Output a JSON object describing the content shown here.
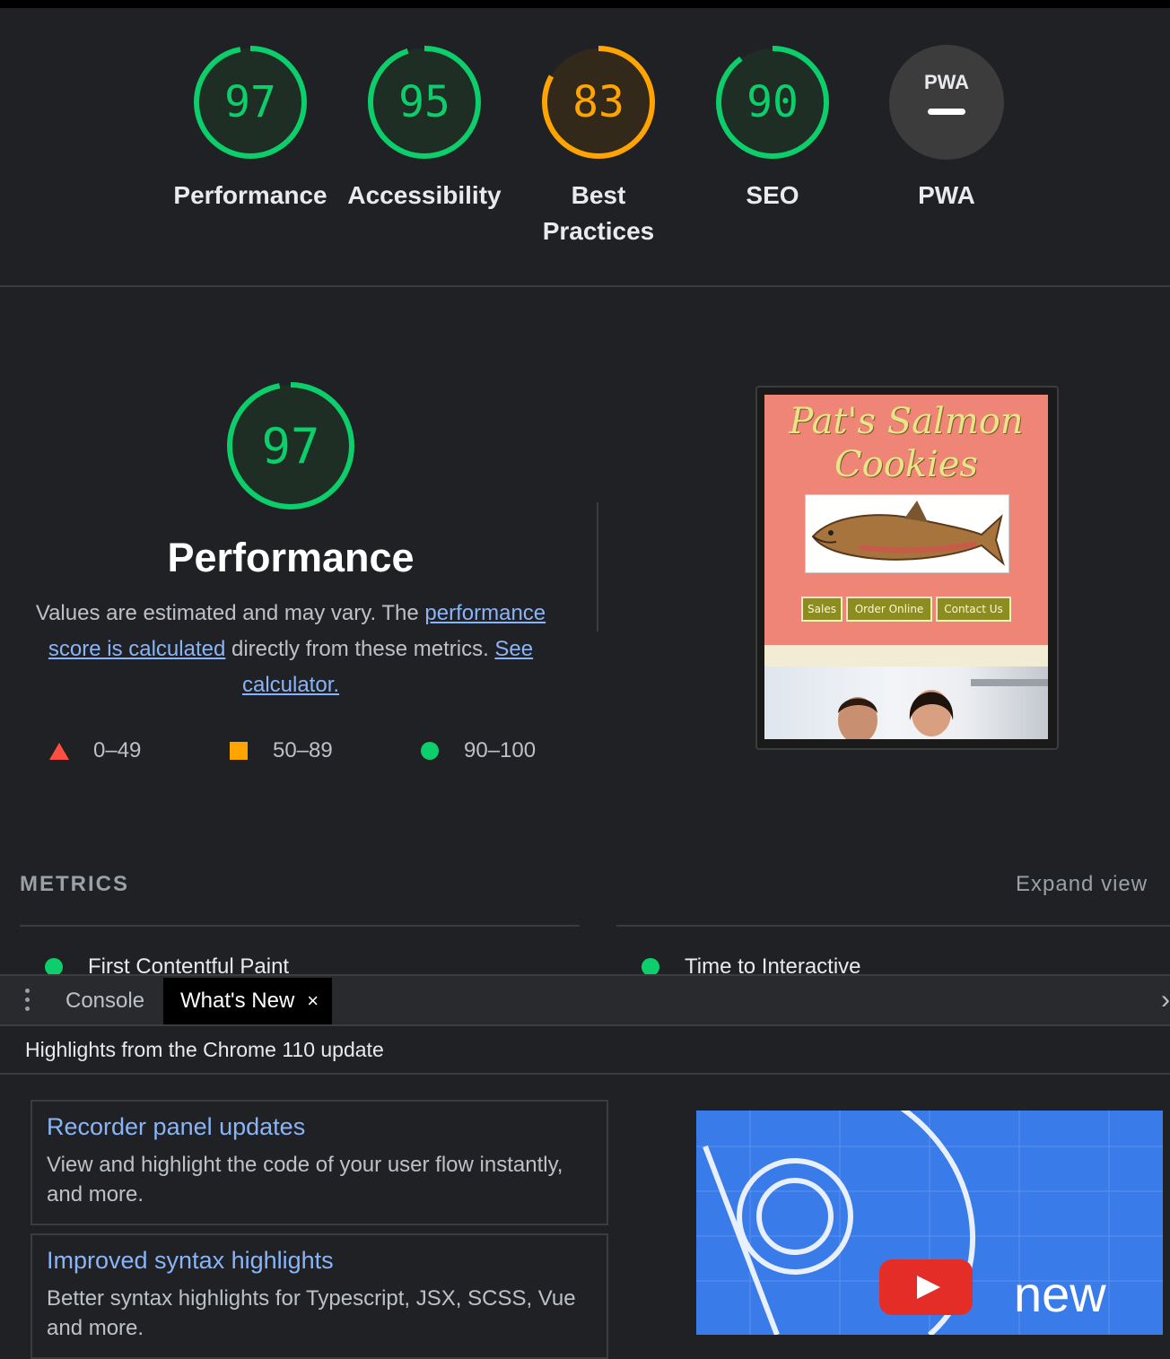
{
  "gauges": [
    {
      "score": "97",
      "label": "Performance",
      "color": "#0cce6b",
      "fill": 0.97
    },
    {
      "score": "95",
      "label": "Accessibility",
      "color": "#0cce6b",
      "fill": 0.95
    },
    {
      "score": "83",
      "label": "Best Practices",
      "color": "#ffa400",
      "fill": 0.83
    },
    {
      "score": "90",
      "label": "SEO",
      "color": "#0cce6b",
      "fill": 0.9
    },
    {
      "score": "PWA",
      "label": "PWA",
      "color": "#9aa0a6",
      "fill": 0
    }
  ],
  "performance": {
    "score": "97",
    "title": "Performance",
    "desc_prefix": "Values are estimated and may vary. The ",
    "desc_link1": "performance score is calculated",
    "desc_middle": " directly from these metrics. ",
    "desc_link2": "See calculator.",
    "legend": [
      {
        "range": "0–49",
        "color": "#ff4e42"
      },
      {
        "range": "50–89",
        "color": "#ffa400"
      },
      {
        "range": "90–100",
        "color": "#0cce6b"
      }
    ]
  },
  "thumbnail": {
    "title": "Pat's Salmon Cookies",
    "nav": [
      "Sales",
      "Order Online",
      "Contact Us"
    ]
  },
  "metrics": {
    "label": "METRICS",
    "expand": "Expand view",
    "items": [
      "First Contentful Paint",
      "Time to Interactive"
    ]
  },
  "drawer": {
    "tabs": [
      "Console",
      "What's New"
    ],
    "close_glyph": "×",
    "arrow_glyph": "›",
    "highlights": "Highlights from the Chrome 110 update",
    "cards": [
      {
        "title": "Recorder panel updates",
        "desc": "View and highlight the code of your user flow instantly, and more."
      },
      {
        "title": "Improved syntax highlights",
        "desc": "Better syntax highlights for Typescript, JSX, SCSS, Vue and more."
      }
    ],
    "video_word": "new"
  }
}
